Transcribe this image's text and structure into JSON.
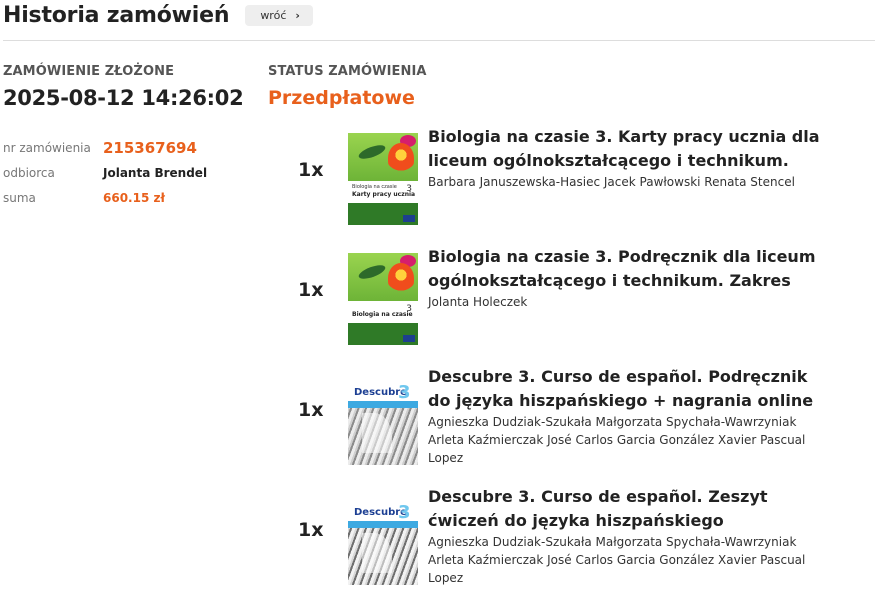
{
  "header": {
    "title": "Historia zamówień",
    "back_label": "wróć",
    "back_icon": "chevron-right-icon"
  },
  "order": {
    "placed_label": "ZAMÓWIENIE ZŁOŻONE",
    "placed_value": "2025-08-12 14:26:02",
    "status_label": "STATUS ZAMÓWIENIA",
    "status_value": "Przedpłatowe",
    "number_label": "nr zamówienia",
    "number_value": "215367694",
    "recipient_label": "odbiorca",
    "recipient_value": "Jolanta Brendel",
    "sum_label": "suma",
    "sum_value": "660.15 zł"
  },
  "items": [
    {
      "qty": "1x",
      "title": "Biologia na czasie 3. Karty pracy ucznia dla liceum ogólnokształcącego i technikum.",
      "authors": "Barbara Januszewska-Hasiec Jacek Pawłowski Renata Stencel",
      "cover": "biology-workbook-cover",
      "cover_text_top": "Biologia na czasie",
      "cover_text_main": "Karty pracy ucznia",
      "cover_num": "3"
    },
    {
      "qty": "1x",
      "title": "Biologia na czasie 3. Podręcznik dla liceum ogólnokształcącego i technikum. Zakres",
      "authors": "Jolanta Holeczek",
      "cover": "biology-textbook-cover",
      "cover_text_top": "",
      "cover_text_main": "Biologia na czasie",
      "cover_num": "3"
    },
    {
      "qty": "1x",
      "title": "Descubre 3. Curso de español. Podręcznik do języka hiszpańskiego + nagrania online",
      "authors": "Agnieszka Dudziak-Szukała Małgorzata Spychała-Wawrzyniak Arleta Kaźmierczak José Carlos Garcia González Xavier Pascual Lopez",
      "cover": "descubre-textbook-cover",
      "cover_brand": "Descubre",
      "cover_num": "3"
    },
    {
      "qty": "1x",
      "title": "Descubre 3. Curso de español. Zeszyt ćwiczeń do języka hiszpańskiego",
      "authors": "Agnieszka Dudziak-Szukała Małgorzata Spychała-Wawrzyniak Arleta Kaźmierczak José Carlos Garcia González Xavier Pascual Lopez",
      "cover": "descubre-workbook-cover",
      "cover_brand": "Descubre",
      "cover_num": "3"
    }
  ],
  "colors": {
    "accent": "#e8601c",
    "text": "#222222",
    "muted": "#777777"
  }
}
